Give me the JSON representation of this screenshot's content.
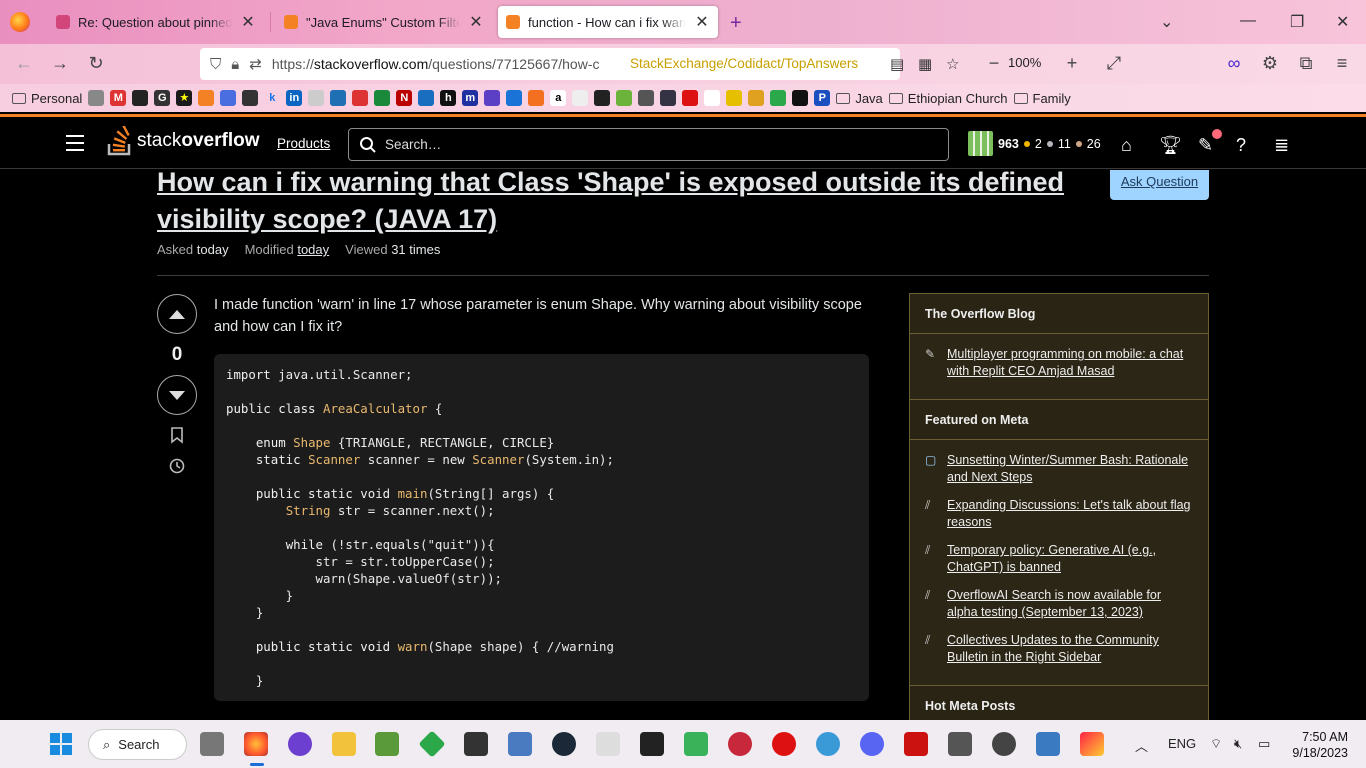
{
  "browser": {
    "tabs": [
      {
        "title": "Re: Question about pinned - da",
        "active": false,
        "favicon_color": "#d1457a"
      },
      {
        "title": "\"Java Enums\" Custom Filtered C",
        "active": false,
        "favicon_color": "#f48225"
      },
      {
        "title": "function - How can i fix warnin",
        "active": true,
        "favicon_color": "#f48225"
      }
    ],
    "url_prefix": "https://",
    "url_host": "stackoverflow.com",
    "url_path": "/questions/77125667/how-c",
    "url_extension_text": "StackExchange/Codidact/TopAnswers",
    "zoom": "100%",
    "bookmarks": [
      "Personal",
      "Java",
      "Ethiopian Church",
      "Family"
    ]
  },
  "so_header": {
    "logo_light": "stack",
    "logo_bold": "overflow",
    "products": "Products",
    "search_placeholder": "Search…",
    "reputation": "963",
    "gold": "2",
    "silver": "11",
    "bronze": "26"
  },
  "question": {
    "title": "How can i fix warning that Class 'Shape' is exposed outside its defined visibility scope? (JAVA 17)",
    "ask_button": "Ask Question",
    "asked_label": "Asked",
    "asked_value": "today",
    "modified_label": "Modified",
    "modified_value": "today",
    "viewed_label": "Viewed",
    "viewed_value": "31 times",
    "score": "0",
    "body": "I made function 'warn' in line 17 whose parameter is enum Shape. Why warning about visibility scope and how can I fix it?"
  },
  "sidebar": {
    "blog_header": "The Overflow Blog",
    "blog_items": [
      "Multiplayer programming on mobile: a chat with Replit CEO Amjad Masad"
    ],
    "meta_header": "Featured on Meta",
    "meta_items": [
      "Sunsetting Winter/Summer Bash: Rationale and Next Steps",
      "Expanding Discussions: Let's talk about flag reasons",
      "Temporary policy: Generative AI (e.g., ChatGPT) is banned",
      "OverflowAI Search is now available for alpha testing (September 13, 2023)",
      "Collectives Updates to the Community Bulletin in the Right Sidebar"
    ],
    "hot_header": "Hot Meta Posts"
  },
  "taskbar": {
    "search": "Search",
    "lang": "ENG",
    "time": "7:50 AM",
    "date": "9/18/2023"
  },
  "colors": {
    "so_orange": "#f48225",
    "ask_button": "#9ed4ff",
    "sidebar_bg": "#2c2616",
    "gold": "#f1b600",
    "silver": "#b4b8bc",
    "bronze": "#d1a684"
  }
}
